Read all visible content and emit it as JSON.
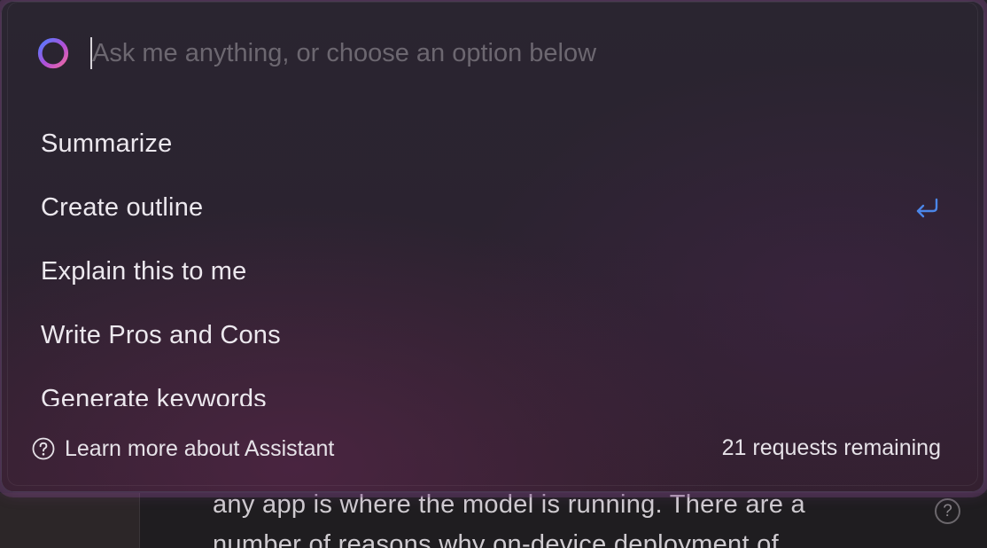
{
  "assistant": {
    "search": {
      "value": "",
      "placeholder": "Ask me anything, or choose an option below"
    },
    "options": [
      {
        "label": "Summarize"
      },
      {
        "label": "Create outline"
      },
      {
        "label": "Explain this to me"
      },
      {
        "label": "Write Pros and Cons"
      },
      {
        "label": "Generate keywords"
      }
    ],
    "highlighted_option_index": 1,
    "footer": {
      "learn_more": "Learn more about Assistant",
      "remaining": "21 requests remaining"
    },
    "colors": {
      "accent_blue": "#4b86e8",
      "orb_gradient": [
        "#5b7cff",
        "#b04fd6",
        "#e86aa6"
      ]
    },
    "icons": {
      "assistant": "assistant-orb-icon",
      "enter": "return-arrow-icon",
      "help": "question-circle-icon"
    }
  },
  "background_document": {
    "lines": [
      "any app is where the model is running. There are a",
      "number of reasons why on-device deployment of"
    ],
    "help_glyph": "?"
  }
}
